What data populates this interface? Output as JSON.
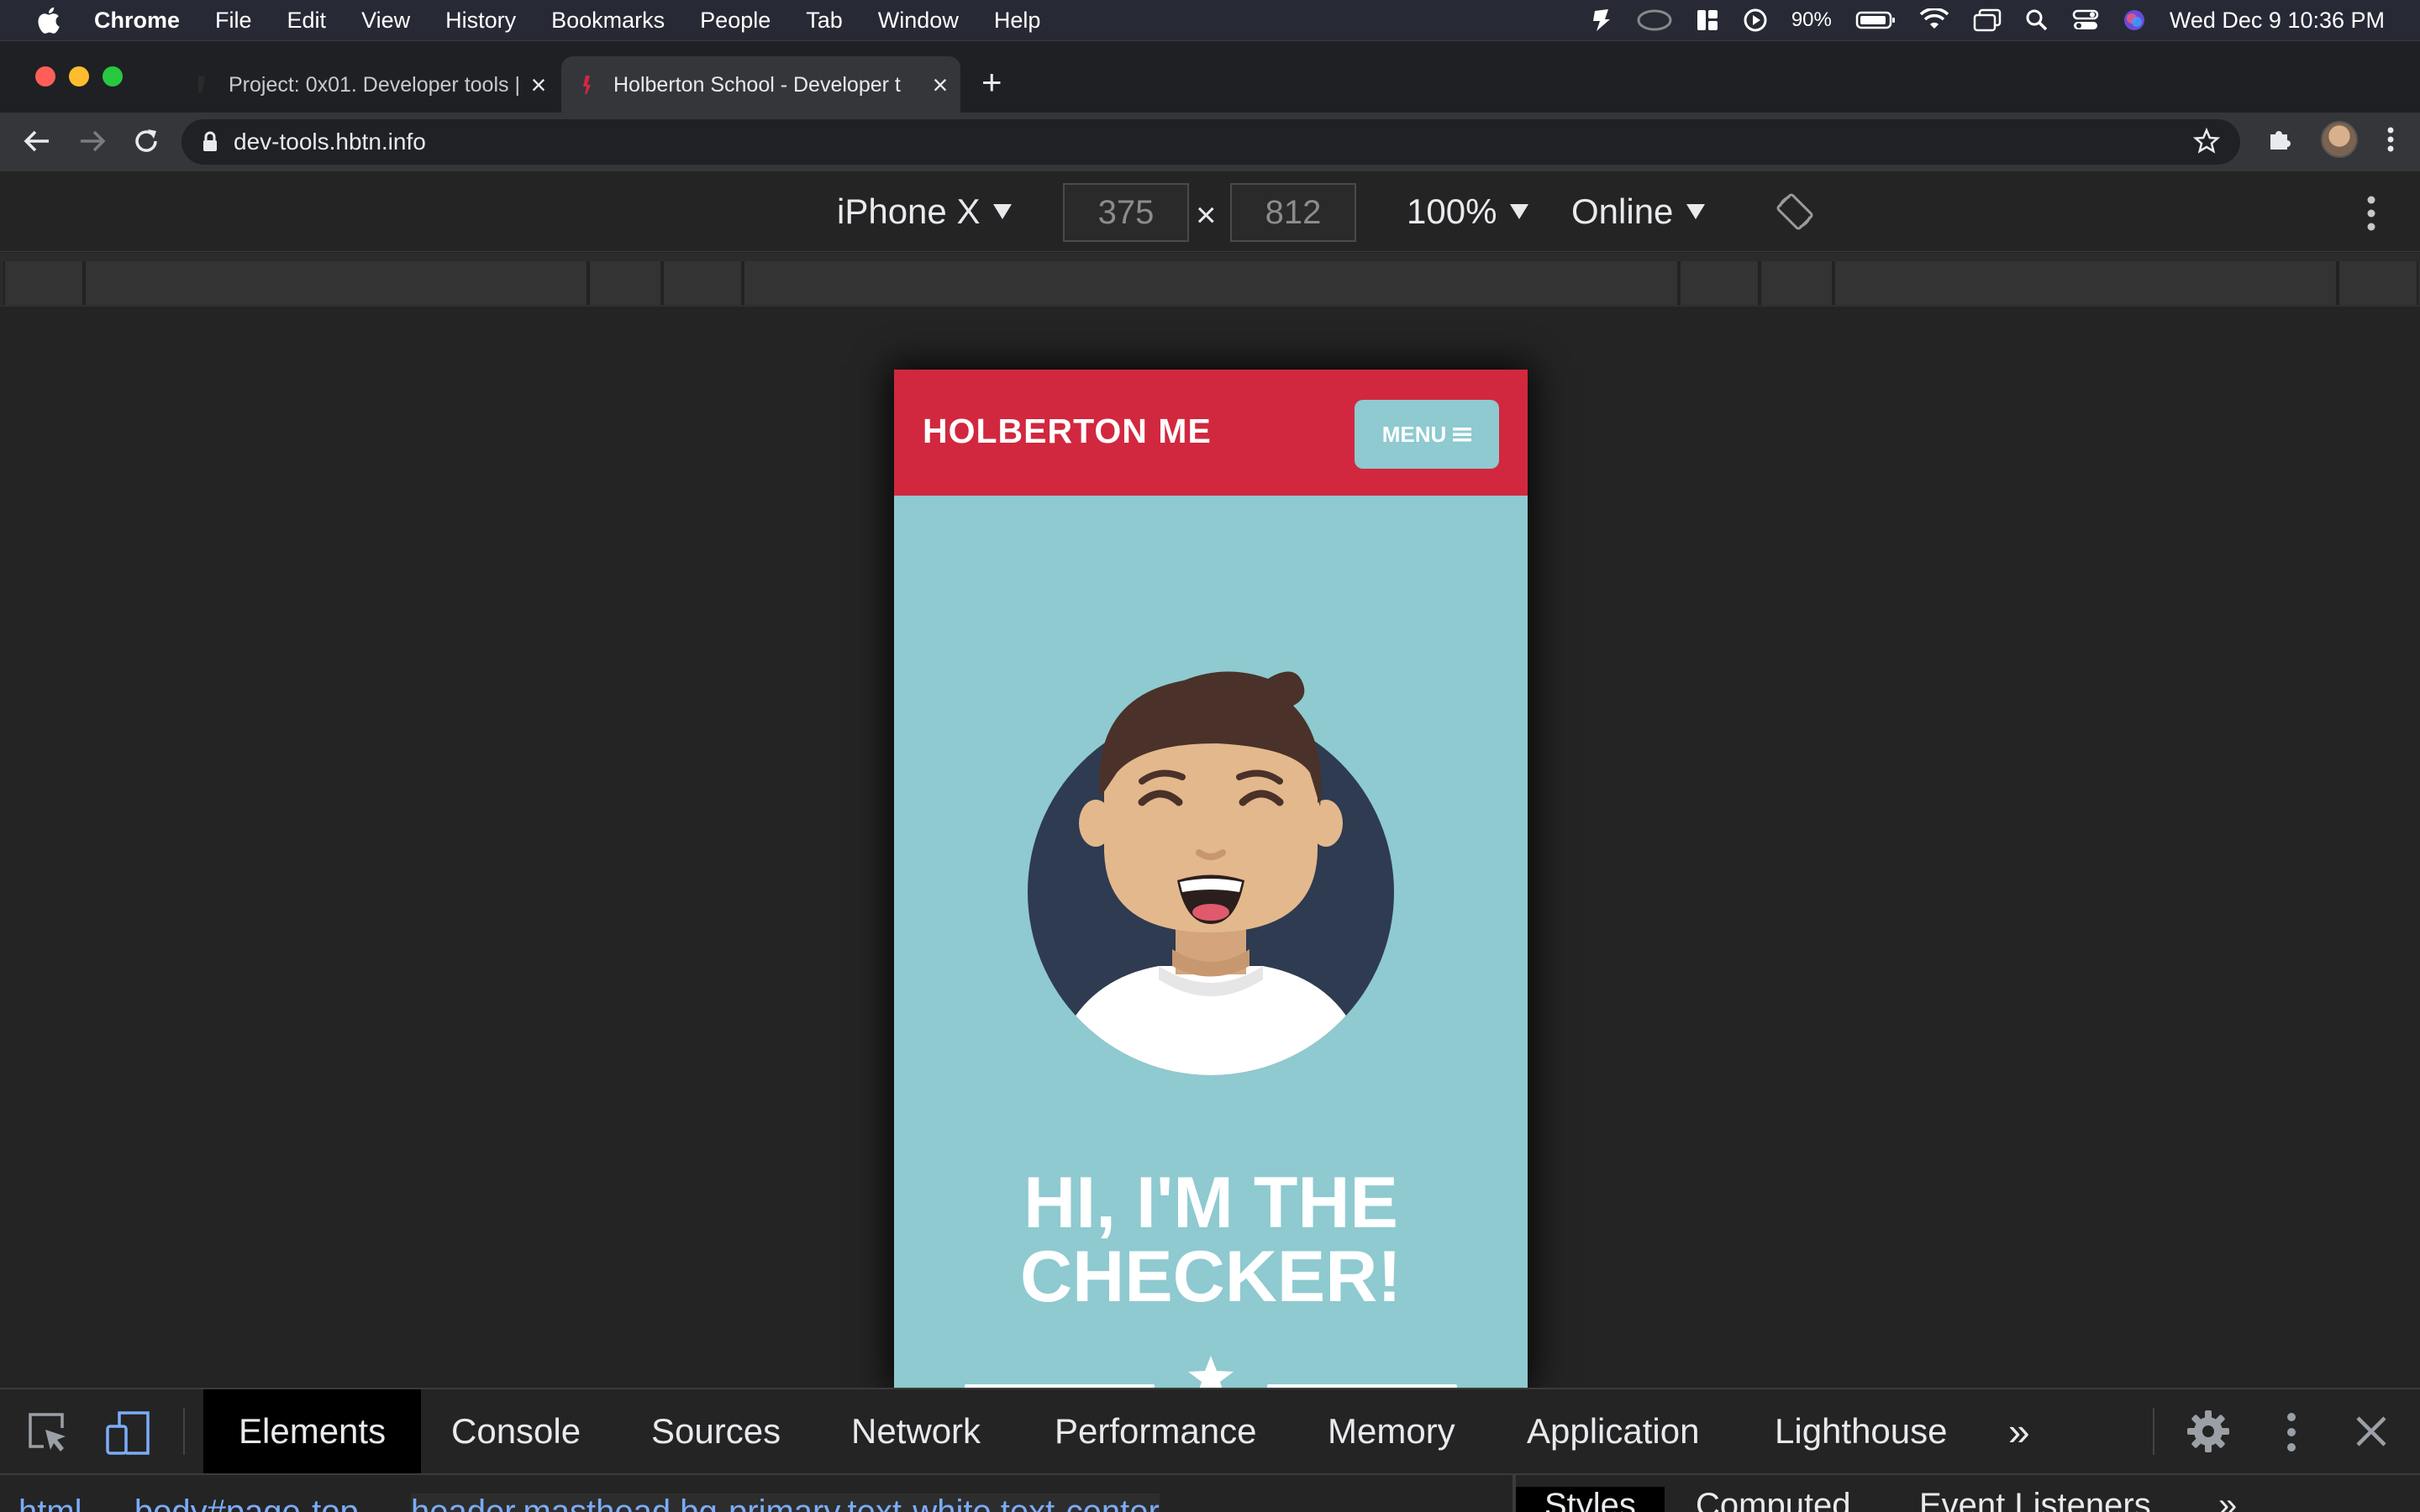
{
  "menubar": {
    "app": "Chrome",
    "items": [
      "File",
      "Edit",
      "View",
      "History",
      "Bookmarks",
      "People",
      "Tab",
      "Window",
      "Help"
    ],
    "battery": "90%",
    "datetime": "Wed Dec 9  10:36 PM"
  },
  "tabs": [
    {
      "title": "Project: 0x01. Developer tools |",
      "active": false
    },
    {
      "title": "Holberton School - Developer t",
      "active": true
    }
  ],
  "omnibox": {
    "url": "dev-tools.hbtn.info"
  },
  "device_toolbar": {
    "device": "iPhone X",
    "width": "375",
    "height": "812",
    "times": "×",
    "zoom": "100%",
    "throttle": "Online"
  },
  "page": {
    "brand": "HOLBERTON ME",
    "menu_label": "MENU",
    "hero_line1": "HI, I'M THE",
    "hero_line2": "CHECKER!",
    "colors": {
      "header": "#d1283f",
      "background": "#8ecad0",
      "avatar_circle": "#2f3b50"
    }
  },
  "devtools": {
    "tabs": [
      "Elements",
      "Console",
      "Sources",
      "Network",
      "Performance",
      "Memory",
      "Application",
      "Lighthouse"
    ],
    "selected_tab": "Elements",
    "more": "»",
    "breadcrumbs": [
      "html",
      "body#page-top",
      "header.masthead.bg-primary.text-white.text-center"
    ],
    "side_tabs": [
      "Styles",
      "Computed",
      "Event Listeners"
    ],
    "side_more": "»"
  }
}
